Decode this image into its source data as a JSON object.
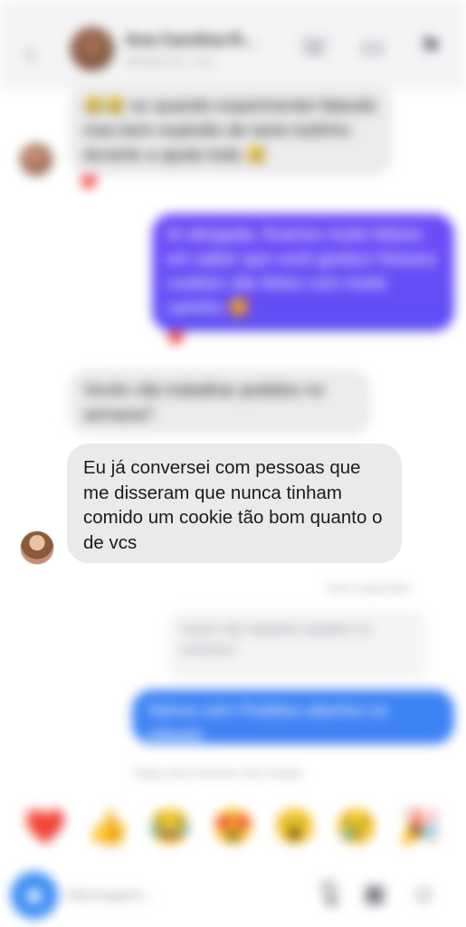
{
  "header": {
    "contact_name": "Ana Carolina R...",
    "contact_status": "Ativo(a) há 1 min",
    "back_icon": "chevron-left-icon",
    "call_icon": "phone-icon",
    "video_icon": "video-camera-icon",
    "info_icon": "flag-icon"
  },
  "messages": [
    {
      "text": "😂😂 eu quando experimentei falando mas bem explodiu de tanto bolinho durante a ajuda toda 😅",
      "reaction": "❤️"
    },
    {
      "text": "Ai obrigada, ficamos muito felizes em saber que você gostou! Nossos cookies são feitos com muito carinho 🥰",
      "reaction": "❤️"
    },
    {
      "text": "Vocês vão trabalhar pedidos no semana?"
    },
    {
      "text": "Eu já conversei com pessoas que me disseram que nunca tinham comido um cookie tão bom quanto o de vcs"
    }
  ],
  "timestamp_note": "Você respondeu",
  "reply_preview": "Vocês vão trabalhar pedidos no semana?",
  "reply_message": "Vamos sim! Pedidos abertos no sábado",
  "swipe_hint": "Toque para reenviar uma reação",
  "emoji_bar": [
    "❤️",
    "👍",
    "😂",
    "😍",
    "😮",
    "😢",
    "🎉"
  ],
  "composer": {
    "placeholder": "Mensagem...",
    "camera_icon": "camera-icon",
    "mic_icon": "microphone-icon",
    "gallery_icon": "image-icon",
    "sticker_icon": "sticker-icon"
  }
}
